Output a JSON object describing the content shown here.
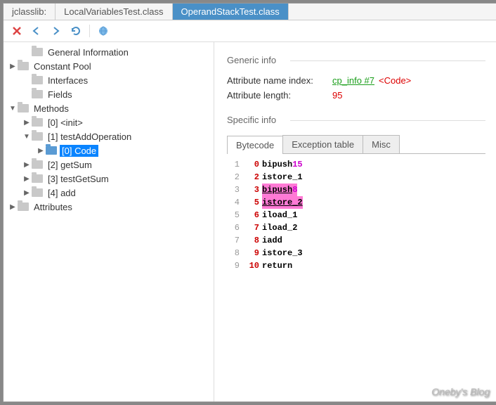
{
  "tabs": [
    {
      "label": "jclasslib:",
      "active": false
    },
    {
      "label": "LocalVariablesTest.class",
      "active": false
    },
    {
      "label": "OperandStackTest.class",
      "active": true
    }
  ],
  "tree": [
    {
      "indent": 1,
      "chev": "",
      "label": "General Information"
    },
    {
      "indent": 0,
      "chev": "▶",
      "label": "Constant Pool"
    },
    {
      "indent": 1,
      "chev": "",
      "label": "Interfaces"
    },
    {
      "indent": 1,
      "chev": "",
      "label": "Fields"
    },
    {
      "indent": 0,
      "chev": "▼",
      "label": "Methods"
    },
    {
      "indent": 1,
      "chev": "▶",
      "label": "[0] <init>"
    },
    {
      "indent": 1,
      "chev": "▼",
      "label": "[1] testAddOperation"
    },
    {
      "indent": 2,
      "chev": "▶",
      "label": "[0] Code",
      "selected": true
    },
    {
      "indent": 1,
      "chev": "▶",
      "label": "[2] getSum"
    },
    {
      "indent": 1,
      "chev": "▶",
      "label": "[3] testGetSum"
    },
    {
      "indent": 1,
      "chev": "▶",
      "label": "[4] add"
    },
    {
      "indent": 0,
      "chev": "▶",
      "label": "Attributes"
    }
  ],
  "generic": {
    "title": "Generic info",
    "attr_name_label": "Attribute name index:",
    "attr_name_link": "cp_info #7",
    "attr_name_tag": "<Code>",
    "attr_len_label": "Attribute length:",
    "attr_len_value": "95"
  },
  "specific": {
    "title": "Specific info",
    "tabs": [
      {
        "label": "Bytecode",
        "active": true
      },
      {
        "label": "Exception table",
        "active": false
      },
      {
        "label": "Misc",
        "active": false
      }
    ]
  },
  "bytecode": [
    {
      "ln": "1",
      "pc": "0",
      "op": "bipush",
      "arg": "15",
      "hl": false
    },
    {
      "ln": "2",
      "pc": "2",
      "op": "istore_1",
      "arg": "",
      "hl": false
    },
    {
      "ln": "3",
      "pc": "3",
      "op": "bipush",
      "arg": "8",
      "hl": true
    },
    {
      "ln": "4",
      "pc": "5",
      "op": "istore_2",
      "arg": "",
      "hl": true
    },
    {
      "ln": "5",
      "pc": "6",
      "op": "iload_1",
      "arg": "",
      "hl": false
    },
    {
      "ln": "6",
      "pc": "7",
      "op": "iload_2",
      "arg": "",
      "hl": false
    },
    {
      "ln": "7",
      "pc": "8",
      "op": "iadd",
      "arg": "",
      "hl": false
    },
    {
      "ln": "8",
      "pc": "9",
      "op": "istore_3",
      "arg": "",
      "hl": false
    },
    {
      "ln": "9",
      "pc": "10",
      "op": "return",
      "arg": "",
      "hl": false
    }
  ],
  "watermark": "Oneby's Blog"
}
